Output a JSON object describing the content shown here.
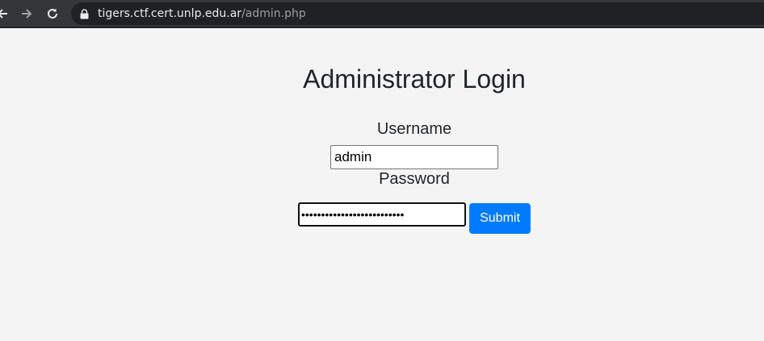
{
  "browser": {
    "url_host": "tigers.ctf.cert.unlp.edu.ar",
    "url_path": "/admin.php",
    "icons": {
      "back": "arrow-left-icon",
      "forward": "arrow-right-icon",
      "reload": "reload-icon",
      "lock": "lock-icon"
    }
  },
  "page": {
    "title": "Administrator Login",
    "username_label": "Username",
    "username_value": "admin",
    "password_label": "Password",
    "password_masked": "••••••••••••••••••••••••••",
    "submit_label": "Submit"
  },
  "colors": {
    "background": "#f4f4f4",
    "browser_bar": "#35363a",
    "submit_button": "#007bff"
  }
}
